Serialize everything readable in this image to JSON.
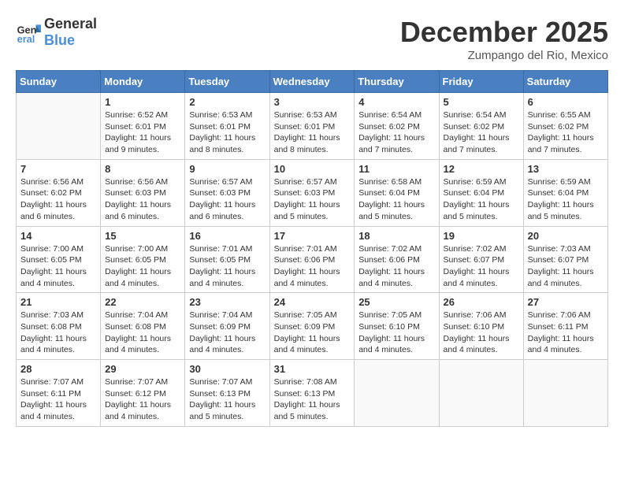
{
  "header": {
    "logo_line1": "General",
    "logo_line2": "Blue",
    "month": "December 2025",
    "location": "Zumpango del Rio, Mexico"
  },
  "weekdays": [
    "Sunday",
    "Monday",
    "Tuesday",
    "Wednesday",
    "Thursday",
    "Friday",
    "Saturday"
  ],
  "weeks": [
    [
      {
        "day": "",
        "info": ""
      },
      {
        "day": "1",
        "info": "Sunrise: 6:52 AM\nSunset: 6:01 PM\nDaylight: 11 hours\nand 9 minutes."
      },
      {
        "day": "2",
        "info": "Sunrise: 6:53 AM\nSunset: 6:01 PM\nDaylight: 11 hours\nand 8 minutes."
      },
      {
        "day": "3",
        "info": "Sunrise: 6:53 AM\nSunset: 6:01 PM\nDaylight: 11 hours\nand 8 minutes."
      },
      {
        "day": "4",
        "info": "Sunrise: 6:54 AM\nSunset: 6:02 PM\nDaylight: 11 hours\nand 7 minutes."
      },
      {
        "day": "5",
        "info": "Sunrise: 6:54 AM\nSunset: 6:02 PM\nDaylight: 11 hours\nand 7 minutes."
      },
      {
        "day": "6",
        "info": "Sunrise: 6:55 AM\nSunset: 6:02 PM\nDaylight: 11 hours\nand 7 minutes."
      }
    ],
    [
      {
        "day": "7",
        "info": "Sunrise: 6:56 AM\nSunset: 6:02 PM\nDaylight: 11 hours\nand 6 minutes."
      },
      {
        "day": "8",
        "info": "Sunrise: 6:56 AM\nSunset: 6:03 PM\nDaylight: 11 hours\nand 6 minutes."
      },
      {
        "day": "9",
        "info": "Sunrise: 6:57 AM\nSunset: 6:03 PM\nDaylight: 11 hours\nand 6 minutes."
      },
      {
        "day": "10",
        "info": "Sunrise: 6:57 AM\nSunset: 6:03 PM\nDaylight: 11 hours\nand 5 minutes."
      },
      {
        "day": "11",
        "info": "Sunrise: 6:58 AM\nSunset: 6:04 PM\nDaylight: 11 hours\nand 5 minutes."
      },
      {
        "day": "12",
        "info": "Sunrise: 6:59 AM\nSunset: 6:04 PM\nDaylight: 11 hours\nand 5 minutes."
      },
      {
        "day": "13",
        "info": "Sunrise: 6:59 AM\nSunset: 6:04 PM\nDaylight: 11 hours\nand 5 minutes."
      }
    ],
    [
      {
        "day": "14",
        "info": "Sunrise: 7:00 AM\nSunset: 6:05 PM\nDaylight: 11 hours\nand 4 minutes."
      },
      {
        "day": "15",
        "info": "Sunrise: 7:00 AM\nSunset: 6:05 PM\nDaylight: 11 hours\nand 4 minutes."
      },
      {
        "day": "16",
        "info": "Sunrise: 7:01 AM\nSunset: 6:05 PM\nDaylight: 11 hours\nand 4 minutes."
      },
      {
        "day": "17",
        "info": "Sunrise: 7:01 AM\nSunset: 6:06 PM\nDaylight: 11 hours\nand 4 minutes."
      },
      {
        "day": "18",
        "info": "Sunrise: 7:02 AM\nSunset: 6:06 PM\nDaylight: 11 hours\nand 4 minutes."
      },
      {
        "day": "19",
        "info": "Sunrise: 7:02 AM\nSunset: 6:07 PM\nDaylight: 11 hours\nand 4 minutes."
      },
      {
        "day": "20",
        "info": "Sunrise: 7:03 AM\nSunset: 6:07 PM\nDaylight: 11 hours\nand 4 minutes."
      }
    ],
    [
      {
        "day": "21",
        "info": "Sunrise: 7:03 AM\nSunset: 6:08 PM\nDaylight: 11 hours\nand 4 minutes."
      },
      {
        "day": "22",
        "info": "Sunrise: 7:04 AM\nSunset: 6:08 PM\nDaylight: 11 hours\nand 4 minutes."
      },
      {
        "day": "23",
        "info": "Sunrise: 7:04 AM\nSunset: 6:09 PM\nDaylight: 11 hours\nand 4 minutes."
      },
      {
        "day": "24",
        "info": "Sunrise: 7:05 AM\nSunset: 6:09 PM\nDaylight: 11 hours\nand 4 minutes."
      },
      {
        "day": "25",
        "info": "Sunrise: 7:05 AM\nSunset: 6:10 PM\nDaylight: 11 hours\nand 4 minutes."
      },
      {
        "day": "26",
        "info": "Sunrise: 7:06 AM\nSunset: 6:10 PM\nDaylight: 11 hours\nand 4 minutes."
      },
      {
        "day": "27",
        "info": "Sunrise: 7:06 AM\nSunset: 6:11 PM\nDaylight: 11 hours\nand 4 minutes."
      }
    ],
    [
      {
        "day": "28",
        "info": "Sunrise: 7:07 AM\nSunset: 6:11 PM\nDaylight: 11 hours\nand 4 minutes."
      },
      {
        "day": "29",
        "info": "Sunrise: 7:07 AM\nSunset: 6:12 PM\nDaylight: 11 hours\nand 4 minutes."
      },
      {
        "day": "30",
        "info": "Sunrise: 7:07 AM\nSunset: 6:13 PM\nDaylight: 11 hours\nand 5 minutes."
      },
      {
        "day": "31",
        "info": "Sunrise: 7:08 AM\nSunset: 6:13 PM\nDaylight: 11 hours\nand 5 minutes."
      },
      {
        "day": "",
        "info": ""
      },
      {
        "day": "",
        "info": ""
      },
      {
        "day": "",
        "info": ""
      }
    ]
  ]
}
